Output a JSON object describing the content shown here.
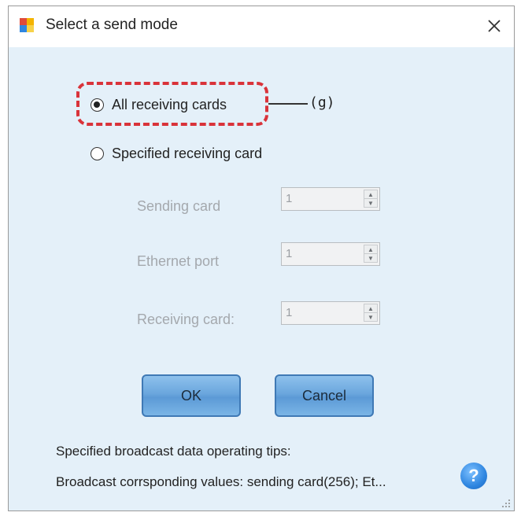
{
  "window": {
    "title": "Select a send mode",
    "app_icon": "app-window-icon",
    "close_icon": "close-icon"
  },
  "send_mode": {
    "options": [
      {
        "label": "All receiving cards",
        "checked": true
      },
      {
        "label": "Specified receiving card",
        "checked": false
      }
    ],
    "callout_label": "(g)"
  },
  "fields": [
    {
      "label": "Sending card",
      "value": "1"
    },
    {
      "label": "Ethernet port",
      "value": "1"
    },
    {
      "label": "Receiving card:",
      "value": "1"
    }
  ],
  "buttons": {
    "ok_label": "OK",
    "cancel_label": "Cancel"
  },
  "tips": {
    "heading": "Specified broadcast data operating tips:",
    "text": "Broadcast corrsponding values: sending card(256); Et...",
    "help_glyph": "?"
  },
  "colors": {
    "accent": "#3f79b5",
    "callout": "#d9333a",
    "background": "#e4f0f9"
  }
}
